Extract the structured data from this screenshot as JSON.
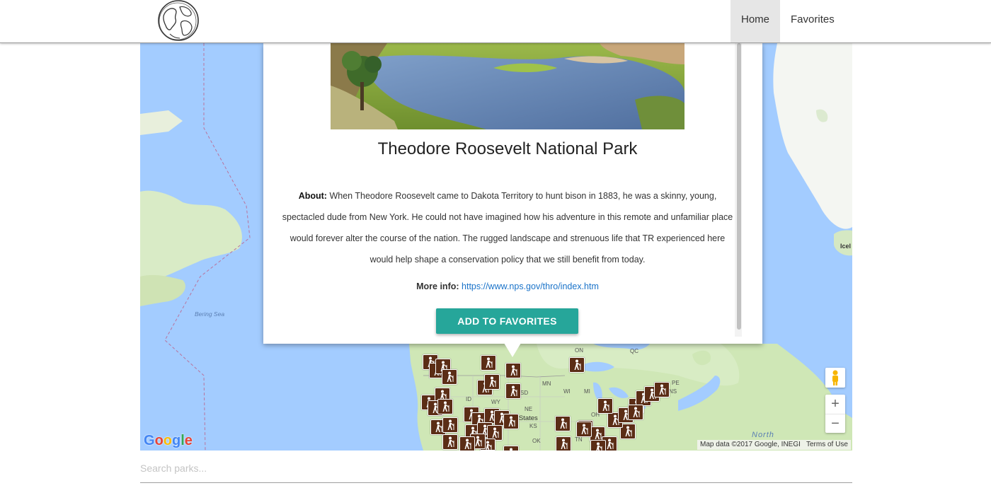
{
  "header": {
    "nav": [
      {
        "label": "Home",
        "active": true
      },
      {
        "label": "Favorites",
        "active": false
      }
    ]
  },
  "map": {
    "labels": [
      "ON",
      "QC",
      "MN",
      "WI",
      "SD",
      "ID",
      "WY",
      "NE",
      "KS",
      "OK",
      "TN",
      "OH",
      "NS",
      "PE",
      "MI",
      "ted States",
      "Icel"
    ],
    "sea_labels": [
      "Bering Sea",
      "North"
    ],
    "google_logo": "Google",
    "attribution": "Map data ©2017 Google, INEGI",
    "terms": "Terms of Use",
    "zoom_in": "+",
    "zoom_out": "−",
    "marker_icon": "hiker-icon",
    "marker_color": "#5b2d16"
  },
  "info_window": {
    "title": "Theodore Roosevelt National Park",
    "about_label": "About:",
    "about_text": "When Theodore Roosevelt came to Dakota Territory to hunt bison in 1883, he was a skinny, young, spectacled dude from New York. He could not have imagined how his adventure in this remote and unfamiliar place would forever alter the course of the nation. The rugged landscape and strenuous life that TR experienced here would help shape a conservation policy that we still benefit from today.",
    "more_label": "More info:",
    "more_url": "https://www.nps.gov/thro/index.htm",
    "button_label": "ADD TO FAVORITES",
    "button_color": "#26a69a"
  },
  "search": {
    "placeholder": "Search parks..."
  }
}
